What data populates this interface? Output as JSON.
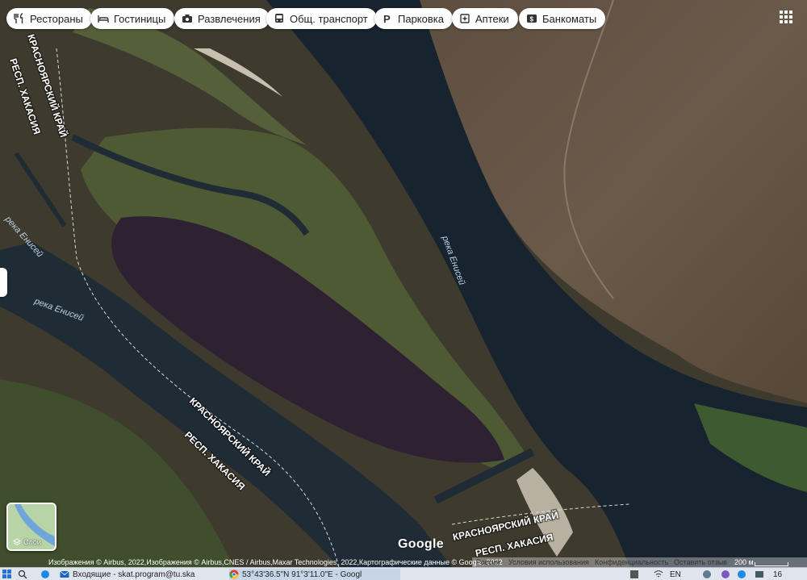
{
  "map": {
    "filter_chips": [
      {
        "label": "Рестораны",
        "icon": "fork-knife-icon"
      },
      {
        "label": "Гостиницы",
        "icon": "bed-icon"
      },
      {
        "label": "Развлечения",
        "icon": "camera-icon"
      },
      {
        "label": "Общ. транспорт",
        "icon": "bus-icon"
      },
      {
        "label": "Парковка",
        "icon": "parking-icon"
      },
      {
        "label": "Аптеки",
        "icon": "pharmacy-icon"
      },
      {
        "label": "Банкоматы",
        "icon": "atm-icon"
      }
    ],
    "labels": {
      "border_krasnoyarsk": "КРАСНОЯРСКИЙ КРАЙ",
      "border_khakassia": "РЕСП. ХАКАСИЯ",
      "river": "река Енисей"
    },
    "layers_label": "Слои",
    "google_logo": "Google",
    "attribution": "Изображения © Airbus, 2022,Изображения © Airbus,CNES / Airbus,Maxar Technologies, 2022,Картографические данные © Google, 2022",
    "footer_links": [
      "Россия",
      "Условия использования",
      "Конфиденциальность",
      "Оставить отзыв"
    ],
    "scale": "200 м",
    "colors": {
      "river": "#1a2a3a",
      "burned_island": "#2e2232",
      "vegetation": "#4d5a3a",
      "hills": "#6b5a4a",
      "sand": "#b8b0a0"
    }
  },
  "taskbar": {
    "tab_inbox": "Входящие - skat.program@tu.ska",
    "tab_chrome": "53°43'36.5\"N 91°3'11.0\"E - Googl",
    "lang": "EN",
    "time": "16"
  }
}
